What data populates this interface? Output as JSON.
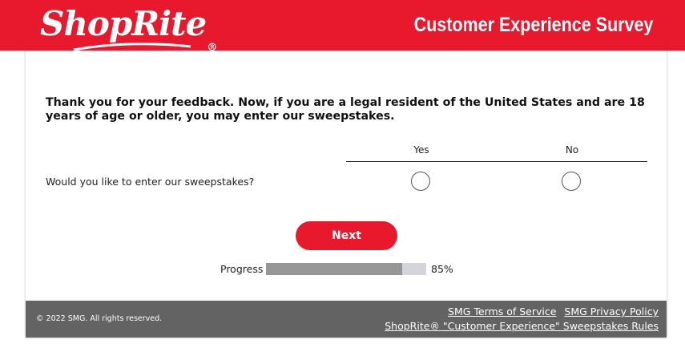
{
  "header": {
    "logo_text": "ShopRite",
    "logo_reg": "®",
    "title": "Customer Experience Survey"
  },
  "survey": {
    "intro": "Thank you for your feedback. Now, if you are a legal resident of the United States and are 18 years of age or older, you may enter our sweepstakes.",
    "columns": [
      "Yes",
      "No"
    ],
    "question": "Would you like to enter our sweepstakes?",
    "next_label": "Next"
  },
  "progress": {
    "label": "Progress",
    "value": 85,
    "text": "85%"
  },
  "footer": {
    "copyright": "© 2022 SMG. All rights reserved.",
    "terms_link": "SMG Terms of Service",
    "privacy_link": "SMG Privacy Policy",
    "rules_link": "ShopRite® \"Customer Experience\" Sweepstakes Rules"
  },
  "colors": {
    "brand_red": "#e8192c",
    "footer_gray": "#636363",
    "progress_fill": "#969696",
    "progress_track": "#d3d5dc"
  }
}
